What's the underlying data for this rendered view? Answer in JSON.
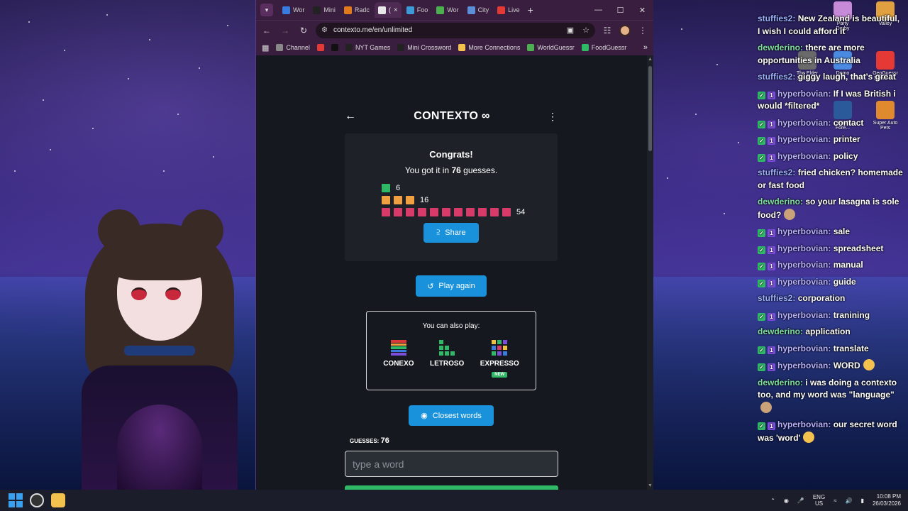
{
  "browser": {
    "tabs": [
      {
        "label": "Wor",
        "color": "#3a7be0",
        "active": false
      },
      {
        "label": "Mini",
        "color": "#222222",
        "active": false
      },
      {
        "label": "Radc",
        "color": "#e07a1a",
        "active": false
      },
      {
        "label": "(",
        "color": "#e8e8e8",
        "active": true
      },
      {
        "label": "Foo",
        "color": "#3a9bd8",
        "active": false
      },
      {
        "label": "Wor",
        "color": "#4caf50",
        "active": false
      },
      {
        "label": "City",
        "color": "#5b8fd8",
        "active": false
      },
      {
        "label": "Live",
        "color": "#e53935",
        "active": false
      }
    ],
    "url": "contexto.me/en/unlimited",
    "bookmarks": [
      {
        "label": "Channel",
        "color": "#888888"
      },
      {
        "label": "",
        "color": "#e53935"
      },
      {
        "label": "",
        "color": "#111111"
      },
      {
        "label": "NYT Games",
        "color": "#222222"
      },
      {
        "label": "Mini Crossword",
        "color": "#222222"
      },
      {
        "label": "More Connections",
        "color": "#f2c14e"
      },
      {
        "label": "WorldGuessr",
        "color": "#4caf50"
      },
      {
        "label": "FoodGuessr",
        "color": "#2fb866"
      }
    ]
  },
  "contexto": {
    "title": "CONTEXTO",
    "congrats": "Congrats!",
    "got_it_prefix": "You got it in",
    "guess_total": "76",
    "got_it_suffix": "guesses.",
    "rows": [
      {
        "count": "6",
        "squares": 1,
        "color": "#2fb866"
      },
      {
        "count": "16",
        "squares": 3,
        "color": "#f0a040"
      },
      {
        "count": "54",
        "squares": 11,
        "color": "#d83a6a"
      }
    ],
    "share_label": "Share",
    "play_again_label": "Play again",
    "also_play_title": "You can also play:",
    "games": [
      {
        "label": "CONEXO",
        "badge": ""
      },
      {
        "label": "LETROSO",
        "badge": ""
      },
      {
        "label": "EXPRESSO",
        "badge": "NEW"
      }
    ],
    "closest_words_label": "Closest words",
    "guesses_label": "GUESSES:",
    "guesses_value": "76",
    "input_placeholder": "type a word"
  },
  "chat": [
    {
      "user": "stuffies2",
      "user_color": "#9bb0ff",
      "text": "New Zealand is beautiful, I wish I could afford it",
      "badges": [],
      "emoji": ""
    },
    {
      "user": "dewderino",
      "user_color": "#7ee0a0",
      "text": "there are more opportunities in Australia",
      "badges": [],
      "emoji": ""
    },
    {
      "user": "stuffies2",
      "user_color": "#9bb0ff",
      "text": "giggy laugh, that's great",
      "badges": [],
      "emoji": ""
    },
    {
      "user": "hyperbovian",
      "user_color": "#b6b0ff",
      "text": "If I was British i would *filtered*",
      "badges": [
        "b1",
        "b2"
      ],
      "emoji": ""
    },
    {
      "user": "hyperbovian",
      "user_color": "#b6b0ff",
      "text": "contact",
      "badges": [
        "b1",
        "b2"
      ],
      "emoji": ""
    },
    {
      "user": "hyperbovian",
      "user_color": "#b6b0ff",
      "text": "printer",
      "badges": [
        "b1",
        "b2"
      ],
      "emoji": ""
    },
    {
      "user": "hyperbovian",
      "user_color": "#b6b0ff",
      "text": "policy",
      "badges": [
        "b1",
        "b2"
      ],
      "emoji": ""
    },
    {
      "user": "stuffies2",
      "user_color": "#9bb0ff",
      "text": "fried chicken? homemade or fast food",
      "badges": [],
      "emoji": ""
    },
    {
      "user": "dewderino",
      "user_color": "#7ee0a0",
      "text": "so your lasagna is sole food?",
      "badges": [],
      "emoji": "face"
    },
    {
      "user": "hyperbovian",
      "user_color": "#b6b0ff",
      "text": "sale",
      "badges": [
        "b1",
        "b2"
      ],
      "emoji": ""
    },
    {
      "user": "hyperbovian",
      "user_color": "#b6b0ff",
      "text": "spreadsheet",
      "badges": [
        "b1",
        "b2"
      ],
      "emoji": ""
    },
    {
      "user": "hyperbovian",
      "user_color": "#b6b0ff",
      "text": "manual",
      "badges": [
        "b1",
        "b2"
      ],
      "emoji": ""
    },
    {
      "user": "hyperbovian",
      "user_color": "#b6b0ff",
      "text": "guide",
      "badges": [
        "b1",
        "b2"
      ],
      "emoji": ""
    },
    {
      "user": "stuffies2",
      "user_color": "#9bb0ff",
      "text": "corporation",
      "badges": [],
      "emoji": ""
    },
    {
      "user": "hyperbovian",
      "user_color": "#b6b0ff",
      "text": "tranining",
      "badges": [
        "b1",
        "b2"
      ],
      "emoji": ""
    },
    {
      "user": "dewderino",
      "user_color": "#7ee0a0",
      "text": "application",
      "badges": [],
      "emoji": ""
    },
    {
      "user": "hyperbovian",
      "user_color": "#b6b0ff",
      "text": "translate",
      "badges": [
        "b1",
        "b2"
      ],
      "emoji": ""
    },
    {
      "user": "hyperbovian",
      "user_color": "#b6b0ff",
      "text": "WORD",
      "badges": [
        "b1",
        "b2"
      ],
      "emoji": "laugh"
    },
    {
      "user": "dewderino",
      "user_color": "#7ee0a0",
      "text": "i was doing a contexto too, and my word was \"language\"",
      "badges": [],
      "emoji": "face"
    },
    {
      "user": "hyperbovian",
      "user_color": "#b6b0ff",
      "text": "our secret word was 'word'",
      "badges": [
        "b1",
        "b2"
      ],
      "emoji": "laugh"
    }
  ],
  "desktop_icons": [
    {
      "label": "Party Derby",
      "color": "#c78ad8"
    },
    {
      "label": "Valley",
      "color": "#e0a040"
    },
    {
      "label": "The Elder Scrolls IV",
      "color": "#6a6a6a"
    },
    {
      "label": "Demo",
      "color": "#4a8ae0"
    },
    {
      "label": "GeoGuessr Steam E...",
      "color": "#e53935"
    },
    {
      "label": "Blind Fore...",
      "color": "#2a5a9a"
    },
    {
      "label": "Super Auto Pets",
      "color": "#e08a30"
    }
  ],
  "taskbar": {
    "lang_top": "ENG",
    "lang_bottom": "US",
    "time": "10:08 PM",
    "date": "26/03/2026"
  }
}
